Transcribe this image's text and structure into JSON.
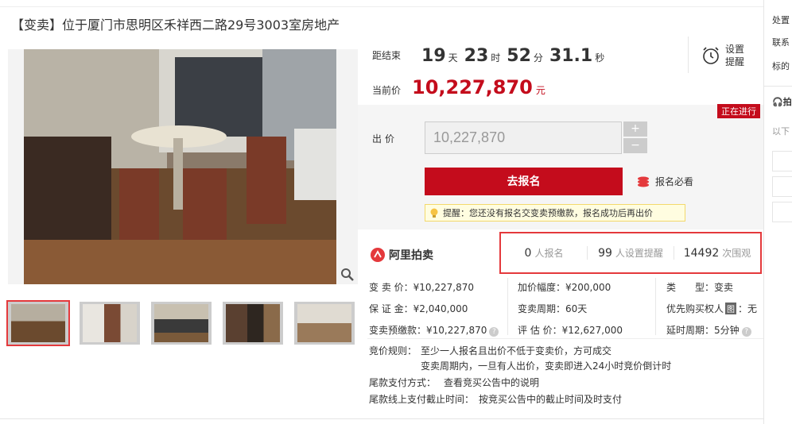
{
  "title": "【变卖】位于厦门市思明区禾祥西二路29号3003室房地产",
  "countdown": {
    "label": "距结束",
    "days": "19",
    "days_unit": "天",
    "hours": "23",
    "hours_unit": "时",
    "minutes": "52",
    "minutes_unit": "分",
    "seconds": "31.1",
    "seconds_unit": "秒"
  },
  "remind": {
    "line1": "设置",
    "line2": "提醒",
    "icon": "alarm-clock-icon"
  },
  "current_price": {
    "label": "当前价",
    "value": "10,227,870",
    "unit": "元"
  },
  "status_badge": "正在进行",
  "bid": {
    "label": "出价",
    "value": "10,227,870",
    "plus": "+",
    "minus": "−"
  },
  "signup_button": "去报名",
  "must_see": "报名必看",
  "tip": "提醒：您还没有报名交变卖预缴款，报名成功后再出价",
  "brand": "阿里拍卖",
  "stats": [
    {
      "n": "0",
      "label": "人报名"
    },
    {
      "n": "99",
      "label": "人设置提醒"
    },
    {
      "n": "14492",
      "label": "次围观"
    }
  ],
  "info": {
    "c1": [
      {
        "k": "变 卖 价：",
        "v": "¥10,227,870"
      },
      {
        "k": "保 证 金：",
        "v": "¥2,040,000"
      },
      {
        "k": "变卖预缴款：",
        "v": "¥10,227,870"
      }
    ],
    "c2": [
      {
        "k": "加价幅度：",
        "v": "¥200,000"
      },
      {
        "k": "变卖周期：",
        "v": "60天"
      },
      {
        "k": "评 估 价：",
        "v": "¥12,627,000"
      }
    ],
    "c3": [
      {
        "k": "类　　型：",
        "v": "变卖"
      },
      {
        "k": "优先购买权人",
        "v": "无"
      },
      {
        "k": "延时周期：",
        "v": "5分钟"
      }
    ],
    "pref_badge": "图"
  },
  "rules": {
    "label": "竞价规则：",
    "line1": "至少一人报名且出价不低于变卖价，方可成交",
    "line2": "变卖周期内，一旦有人出价，变卖即进入24小时竞价倒计时",
    "pay_label": "尾款支付方式：",
    "pay_value": "查看竞买公告中的说明",
    "deadline_label": "尾款线上支付截止时间：",
    "deadline_value": "按竞买公告中的截止时间及时支付"
  },
  "sidebar": {
    "item1": "处置",
    "item2": "联系",
    "item3": "标的",
    "section": "拍",
    "sub": "以下"
  }
}
